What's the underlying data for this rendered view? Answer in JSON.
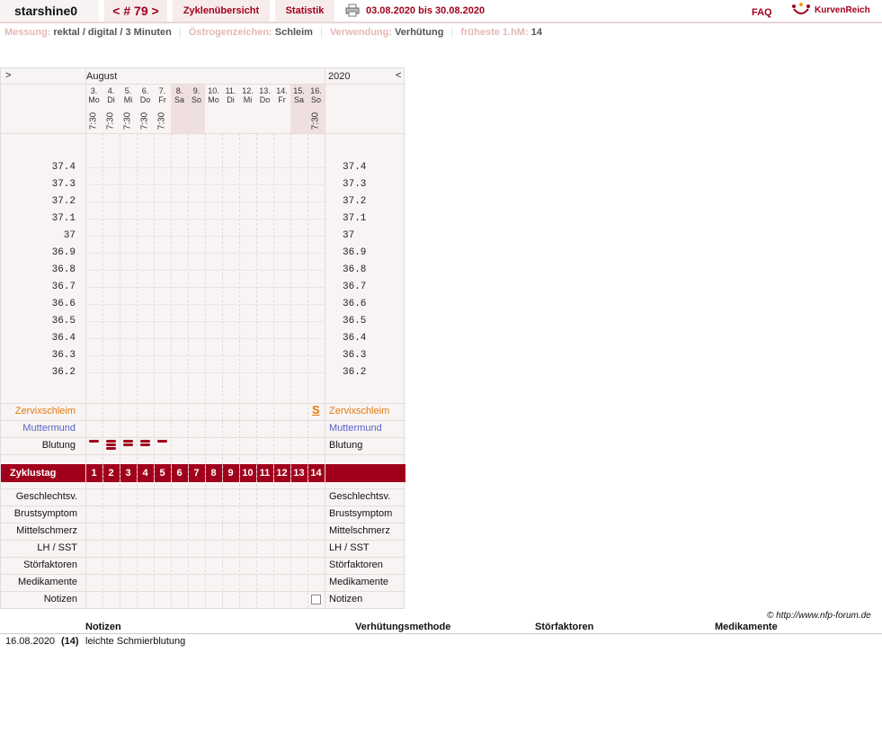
{
  "header": {
    "username": "starshine0",
    "cycle_nav": "< # 79 >",
    "tab_zyklen": "Zyklenübersicht",
    "tab_statistik": "Statistik",
    "date_range": "03.08.2020 bis 30.08.2020",
    "faq": "FAQ",
    "logo_text": "KurvenReich"
  },
  "meta": {
    "messung_label": "Messung:",
    "messung_value": "rektal / digital / 3 Minuten",
    "oestrogen_label": "Östrogenzeichen:",
    "oestrogen_value": "Schleim",
    "verwendung_label": "Verwendung:",
    "verwendung_value": "Verhütung",
    "fruehste_label": "früheste 1.hM:",
    "fruehste_value": "14"
  },
  "chart": {
    "nav_left": ">",
    "month": "August",
    "year": "2020",
    "nav_right": "<",
    "days": [
      {
        "num": "3.",
        "wd": "Mo",
        "time": "7:30",
        "weekend": false
      },
      {
        "num": "4.",
        "wd": "Di",
        "time": "7:30",
        "weekend": false
      },
      {
        "num": "5.",
        "wd": "Mi",
        "time": "7:30",
        "weekend": false
      },
      {
        "num": "6.",
        "wd": "Do",
        "time": "7:30",
        "weekend": false
      },
      {
        "num": "7.",
        "wd": "Fr",
        "time": "7:30",
        "weekend": false
      },
      {
        "num": "8.",
        "wd": "Sa",
        "time": "",
        "weekend": true
      },
      {
        "num": "9.",
        "wd": "So",
        "time": "",
        "weekend": true
      },
      {
        "num": "10.",
        "wd": "Mo",
        "time": "",
        "weekend": false
      },
      {
        "num": "11.",
        "wd": "Di",
        "time": "",
        "weekend": false
      },
      {
        "num": "12.",
        "wd": "Mi",
        "time": "",
        "weekend": false
      },
      {
        "num": "13.",
        "wd": "Do",
        "time": "",
        "weekend": false
      },
      {
        "num": "14.",
        "wd": "Fr",
        "time": "",
        "weekend": false
      },
      {
        "num": "15.",
        "wd": "Sa",
        "time": "",
        "weekend": true
      },
      {
        "num": "16.",
        "wd": "So",
        "time": "7:30",
        "weekend": true
      }
    ],
    "temps": [
      "37.4",
      "37.3",
      "37.2",
      "37.1",
      "37",
      "36.9",
      "36.8",
      "36.7",
      "36.6",
      "36.5",
      "36.4",
      "36.3",
      "36.2"
    ],
    "rows_top": [
      {
        "label": "Zervixschleim",
        "color": "#e07a10"
      },
      {
        "label": "Muttermund",
        "color": "#5562c8"
      },
      {
        "label": "Blutung",
        "color": "#111111"
      }
    ],
    "bleeding_levels": [
      1,
      3,
      2,
      2,
      1,
      0,
      0,
      0,
      0,
      0,
      0,
      0,
      0,
      0
    ],
    "mucus_symbol_day": 14,
    "mucus_symbol": "S",
    "zyklustag_label": "Zyklustag",
    "zyklustage": [
      "1",
      "2",
      "3",
      "4",
      "5",
      "6",
      "7",
      "8",
      "9",
      "10",
      "11",
      "12",
      "13",
      "14"
    ],
    "rows_bottom": [
      "Geschlechtsv.",
      "Brustsymptom",
      "Mittelschmerz",
      "LH / SST",
      "Störfaktoren",
      "Medikamente",
      "Notizen"
    ],
    "accent": "#a1001c"
  },
  "copyright": "© http://www.nfp-forum.de",
  "notes": {
    "headers": [
      "Notizen",
      "Verhütungsmethode",
      "Störfaktoren",
      "Medikamente"
    ],
    "rows": [
      {
        "date": "16.08.2020",
        "day": "(14)",
        "text": "leichte Schmierblutung"
      }
    ]
  }
}
